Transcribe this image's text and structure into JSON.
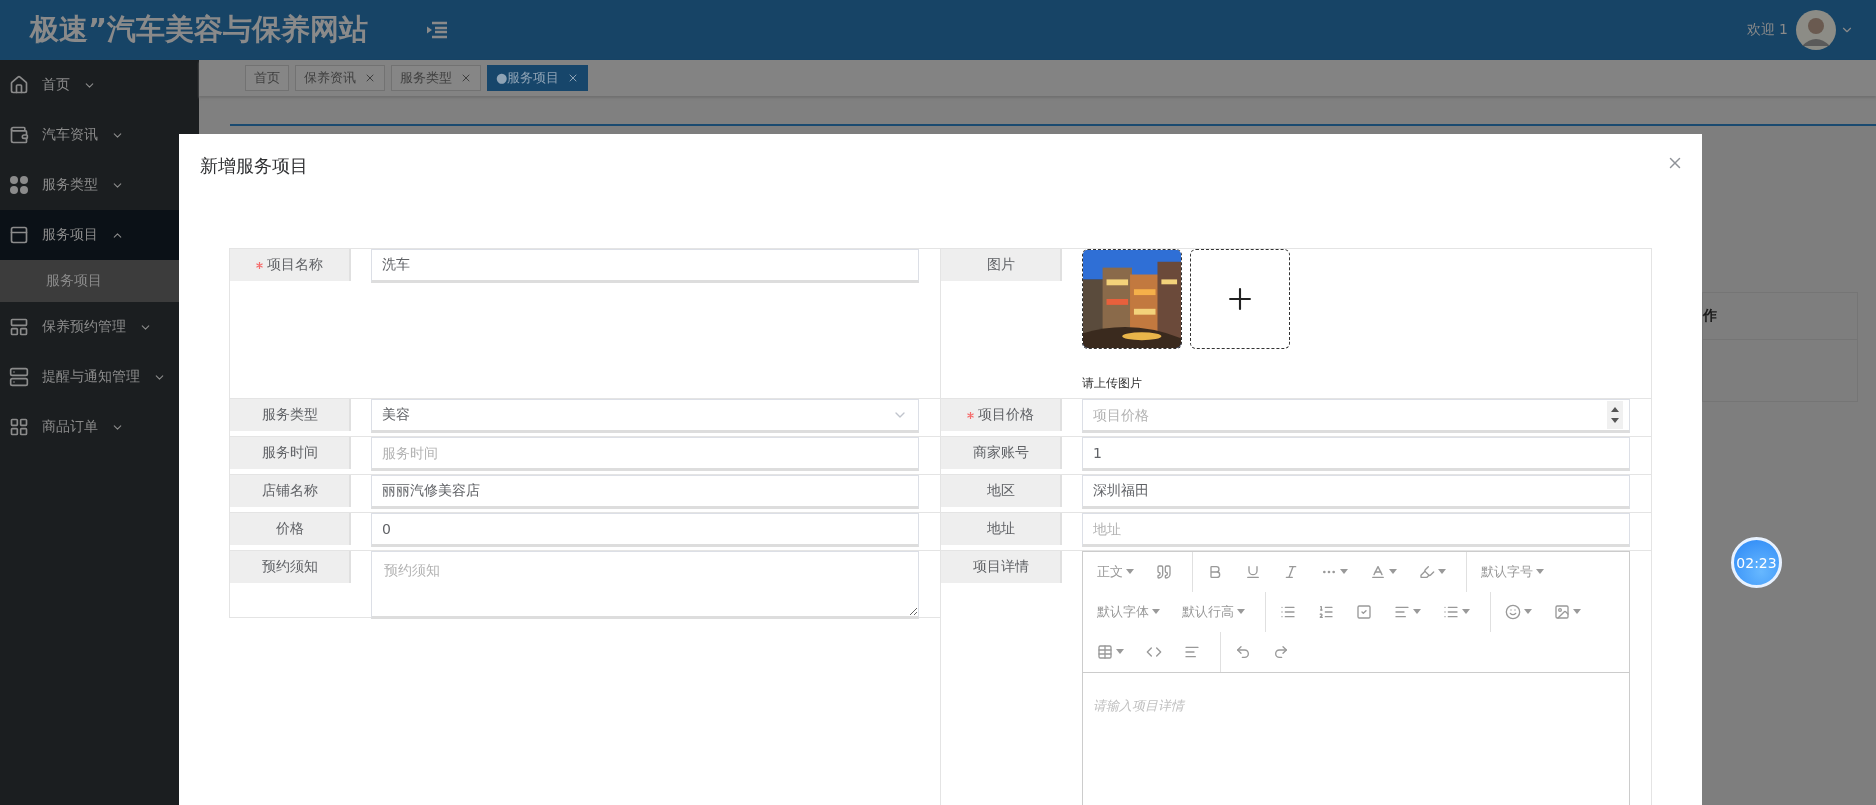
{
  "header": {
    "title": "极速”汽车美容与保养网站",
    "welcome": "欢迎 1"
  },
  "sidebar": {
    "items": [
      {
        "label": "首页",
        "expanded": false,
        "selected": false
      },
      {
        "label": "汽车资讯",
        "expanded": false,
        "selected": false
      },
      {
        "label": "服务类型",
        "expanded": false,
        "selected": false
      },
      {
        "label": "服务项目",
        "expanded": true,
        "selected": true,
        "children": [
          {
            "label": "服务项目",
            "selected": true
          }
        ]
      },
      {
        "label": "保养预约管理",
        "expanded": false,
        "selected": false
      },
      {
        "label": "提醒与通知管理",
        "expanded": false,
        "selected": false
      },
      {
        "label": "商品订单",
        "expanded": false,
        "selected": false
      }
    ]
  },
  "tabs": [
    {
      "label": "首页",
      "selected": false,
      "closable": false
    },
    {
      "label": "保养资讯",
      "selected": false,
      "closable": true
    },
    {
      "label": "服务类型",
      "selected": false,
      "closable": true
    },
    {
      "label": "●服务项目",
      "selected": true,
      "closable": true
    }
  ],
  "background_table": {
    "columns": [
      "作"
    ]
  },
  "modal": {
    "title": "新增服务项目",
    "left_fields": [
      {
        "kind": "text",
        "label": "项目名称",
        "required": true,
        "value": "洗车"
      },
      {
        "kind": "select",
        "label": "服务类型",
        "required": false,
        "value": "美容"
      },
      {
        "kind": "text",
        "label": "服务时间",
        "required": false,
        "placeholder": "服务时间"
      },
      {
        "kind": "text",
        "label": "店铺名称",
        "required": false,
        "value": "丽丽汽修美容店"
      },
      {
        "kind": "text",
        "label": "价格",
        "required": false,
        "value": "0"
      },
      {
        "kind": "textarea",
        "label": "预约须知",
        "required": false,
        "placeholder": "预约须知"
      }
    ],
    "right_fields": [
      {
        "kind": "upload",
        "label": "图片",
        "required": false,
        "hint": "请上传图片"
      },
      {
        "kind": "number",
        "label": "项目价格",
        "required": true,
        "placeholder": "项目价格"
      },
      {
        "kind": "text",
        "label": "商家账号",
        "required": false,
        "value": "1"
      },
      {
        "kind": "text",
        "label": "地区",
        "required": false,
        "value": "深圳福田"
      },
      {
        "kind": "text",
        "label": "地址",
        "required": false,
        "placeholder": "地址"
      },
      {
        "kind": "editor",
        "label": "项目详情",
        "required": false,
        "toolbar_labels": [
          "正文",
          "默认字号",
          "默认字体",
          "默认行高"
        ],
        "placeholder": "请输入项目详情"
      }
    ]
  },
  "timer": "02:23"
}
